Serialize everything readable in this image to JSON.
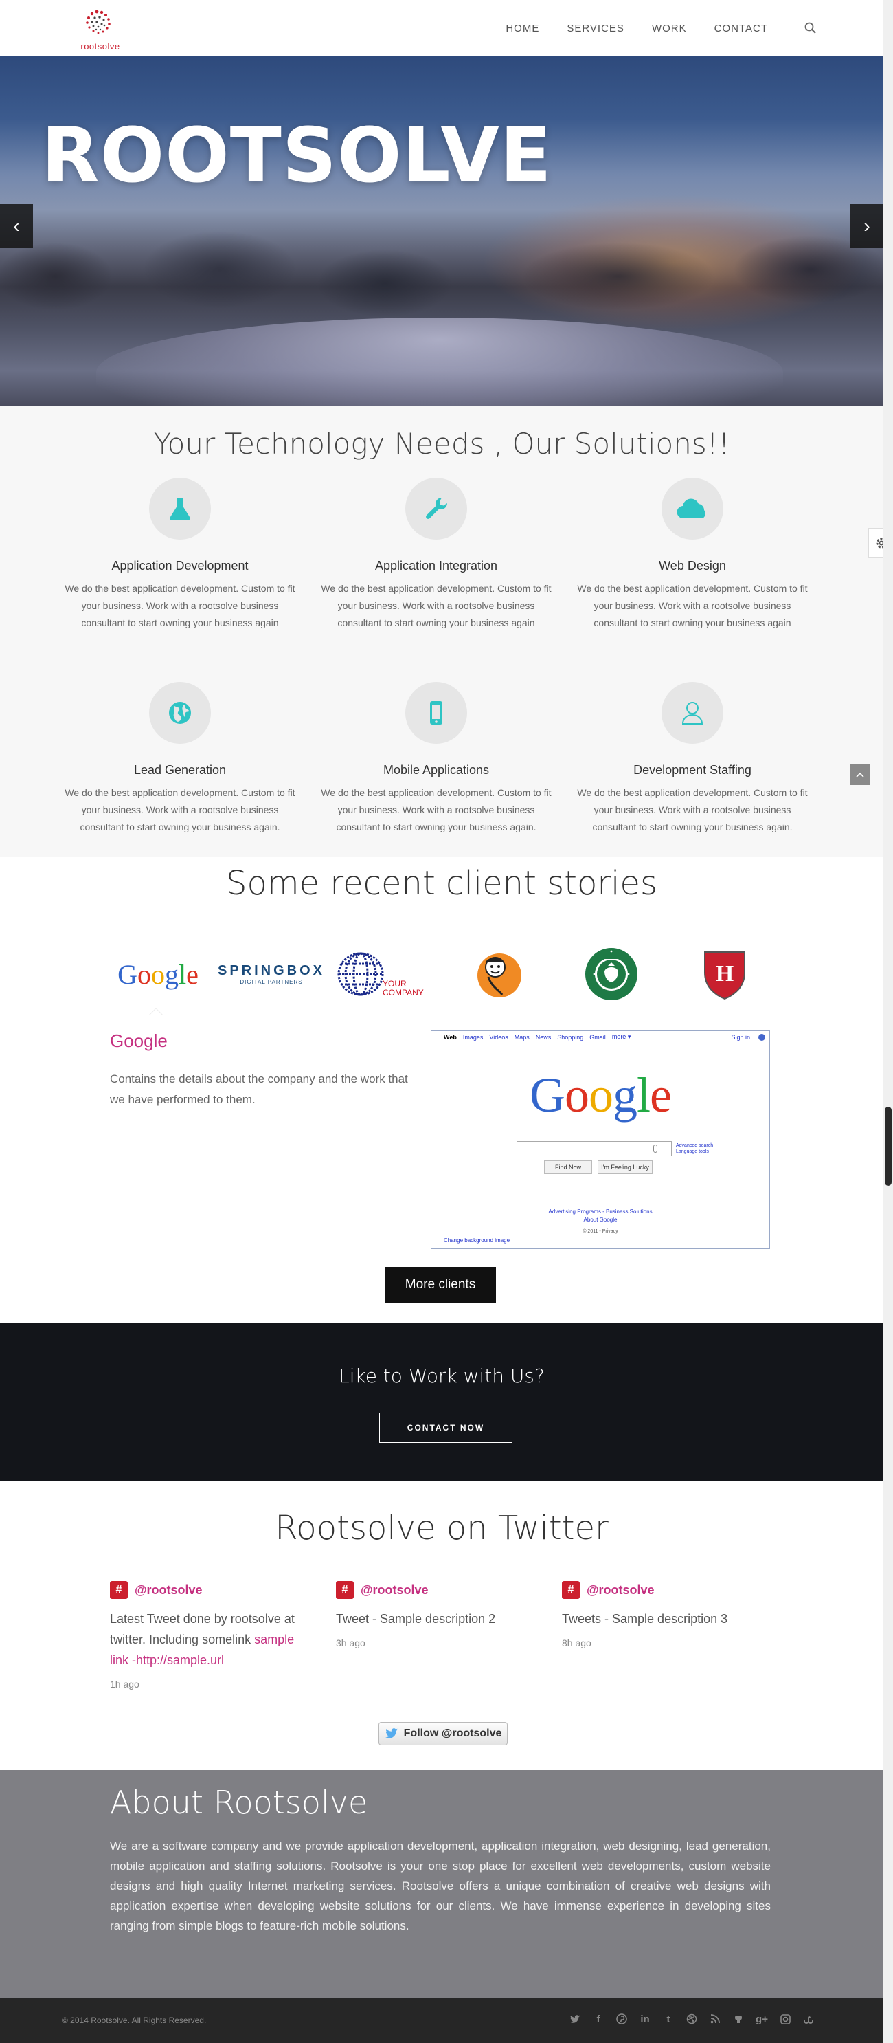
{
  "header": {
    "logo_text": "rootsolve",
    "nav": [
      "HOME",
      "SERVICES",
      "WORK",
      "CONTACT"
    ]
  },
  "hero": {
    "title": "ROOTSOLVE",
    "prev_label": "‹",
    "next_label": "›"
  },
  "services": {
    "title": "Your Technology Needs , Our Solutions!!",
    "items": [
      {
        "title": "Application Development",
        "desc": "We do the best application development. Custom to fit your business. Work with a rootsolve business consultant to start owning your business again",
        "icon": "flask-icon"
      },
      {
        "title": "Application Integration",
        "desc": "We do the best application development. Custom to fit your business. Work with a rootsolve business consultant to start owning your business again",
        "icon": "wrench-icon"
      },
      {
        "title": "Web Design",
        "desc": "We do the best application development. Custom to fit your business. Work with a rootsolve business consultant to start owning your business again",
        "icon": "cloud-icon"
      },
      {
        "title": "Lead Generation",
        "desc": "We do the best application development. Custom to fit your business. Work with a rootsolve business consultant to start owning your business again.",
        "icon": "globe-icon"
      },
      {
        "title": "Mobile Applications",
        "desc": "We do the best application development. Custom to fit your business. Work with a rootsolve business consultant to start owning your business again.",
        "icon": "mobile-icon"
      },
      {
        "title": "Development Staffing",
        "desc": "We do the best application development. Custom to fit your business. Work with a rootsolve business consultant to start owning your business again.",
        "icon": "user-icon"
      }
    ],
    "accent_color": "#2ec4c4"
  },
  "clients": {
    "title": "Some recent client stories",
    "logos": {
      "google": "Google",
      "springbox": "SPRINGBOX",
      "springbox_sub": "DIGITAL PARTNERS",
      "yourcompany_1": "YOUR",
      "yourcompany_2": "COMPANY",
      "starbucks": "STARBUCKS COFFEE",
      "harvard": "H"
    },
    "selected_name": "Google",
    "selected_desc": "Contains the details about the company and the work that we have performed to them.",
    "screenshot": {
      "nav": [
        "Web",
        "Images",
        "Videos",
        "Maps",
        "News",
        "Shopping",
        "Gmail",
        "more ▾"
      ],
      "signin": "Sign in",
      "logo": "Google",
      "search_btn": "Find Now",
      "lucky_btn": "I'm Feeling Lucky",
      "advanced": "Advanced search",
      "language": "Language tools",
      "links": "Advertising Programs  -  Business Solutions",
      "about": "About Google",
      "copyright": "© 2011 - Privacy",
      "change_bg": "Change background image"
    },
    "more_label": "More clients"
  },
  "cta": {
    "title": "Like to Work with Us?",
    "button": "CONTACT NOW"
  },
  "twitter": {
    "title": "Rootsolve on Twitter",
    "tweets": [
      {
        "handle": "@rootsolve",
        "text": "Latest Tweet done by rootsolve at twitter. Including somelink ",
        "link": "sample link -http://sample.url",
        "time": "1h ago"
      },
      {
        "handle": "@rootsolve",
        "text": "Tweet - Sample description 2",
        "time": "3h ago"
      },
      {
        "handle": "@rootsolve",
        "text": "Tweets - Sample description 3",
        "time": "8h ago"
      }
    ],
    "follow_label": "Follow @rootsolve"
  },
  "about": {
    "title": "About Rootsolve",
    "text": "We are a software company and we provide application development, application integration, web designing, lead generation, mobile application and staffing solutions. Rootsolve is your one stop place for excellent web developments, custom website designs and high quality Internet marketing services. Rootsolve offers a unique combination of creative web designs with application expertise when developing website solutions for our clients. We have immense experience in developing sites ranging from simple blogs to feature-rich mobile solutions."
  },
  "footer": {
    "copyright": "© 2014 Rootsolve. All Rights Reserved.",
    "social": [
      "twitter-icon",
      "facebook-icon",
      "pinterest-icon",
      "linkedin-icon",
      "tumblr-icon",
      "dribbble-icon",
      "rss-icon",
      "github-icon",
      "googleplus-icon",
      "instagram-icon",
      "stumbleupon-icon"
    ]
  }
}
